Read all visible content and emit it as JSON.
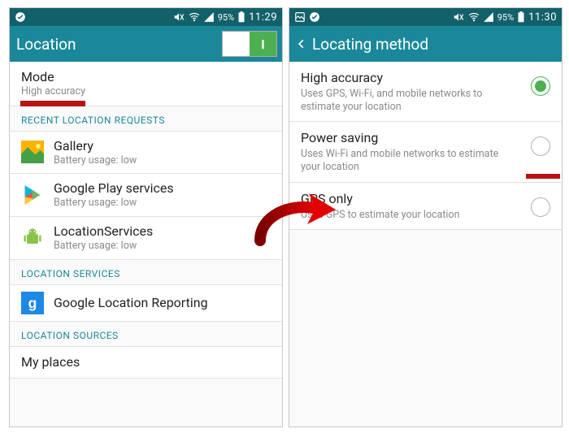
{
  "left": {
    "status": {
      "battery": "95%",
      "time": "11:29"
    },
    "title": "Location",
    "toggle_on_glyph": "I",
    "mode": {
      "label": "Mode",
      "value": "High accuracy"
    },
    "section_recent": "RECENT LOCATION REQUESTS",
    "apps": [
      {
        "name": "Gallery",
        "sub": "Battery usage: low"
      },
      {
        "name": "Google Play services",
        "sub": "Battery usage: low"
      },
      {
        "name": "LocationServices",
        "sub": "Battery usage: low"
      }
    ],
    "section_services": "LOCATION SERVICES",
    "reporting": "Google Location Reporting",
    "section_sources": "LOCATION SOURCES",
    "places": "My places"
  },
  "right": {
    "status": {
      "battery": "95%",
      "time": "11:30"
    },
    "title": "Locating method",
    "opts": [
      {
        "title": "High accuracy",
        "sub": "Uses GPS, Wi-Fi, and mobile networks to estimate your location",
        "selected": true
      },
      {
        "title": "Power saving",
        "sub": "Uses Wi-Fi and mobile networks to estimate your location",
        "selected": false
      },
      {
        "title": "GPS only",
        "sub": "Uses GPS to estimate your location",
        "selected": false
      }
    ]
  }
}
